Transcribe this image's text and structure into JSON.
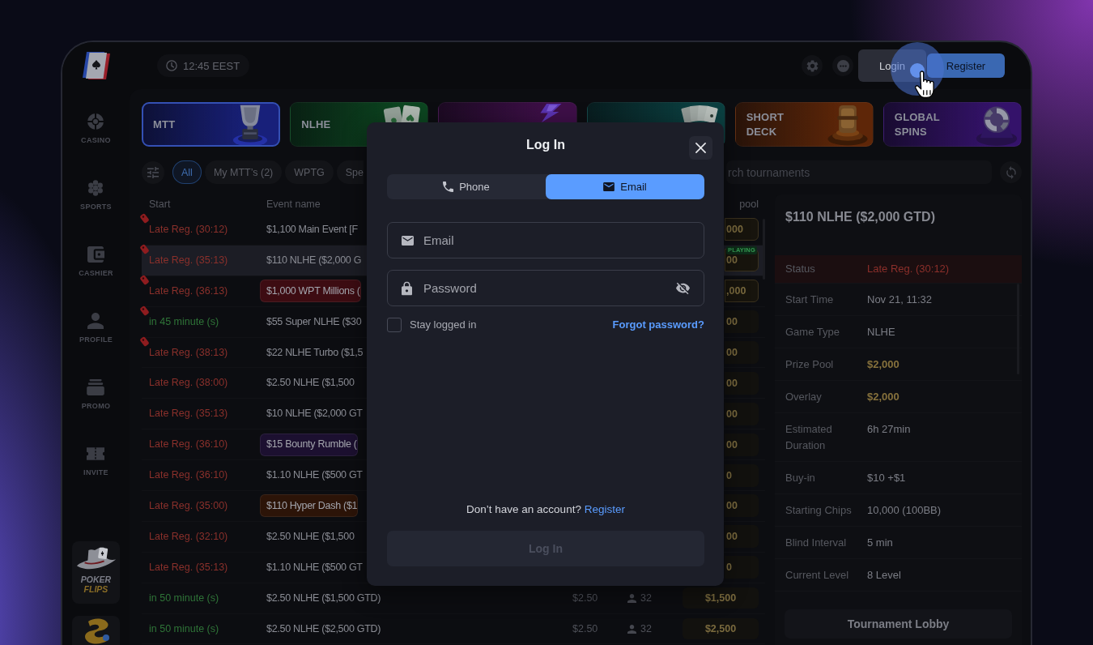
{
  "sidebar": {
    "items": [
      {
        "label": "CASINO"
      },
      {
        "label": "SPORTS"
      },
      {
        "label": "CASHIER"
      },
      {
        "label": "PROFILE"
      },
      {
        "label": "PROMO"
      },
      {
        "label": "INVITE"
      }
    ],
    "promo": {
      "title": "POKER",
      "subtitle": "FLIPS"
    }
  },
  "top_bar": {
    "clock": "12:45 EEST",
    "buttons": [
      {
        "label": "Login",
        "kind": "secondary"
      },
      {
        "label": "Register",
        "kind": "primary"
      }
    ]
  },
  "game_tiles": [
    {
      "label": "MTT",
      "selected": true,
      "color": "#18207a"
    },
    {
      "label": "NLHE",
      "selected": false,
      "color": "#0c4520"
    },
    {
      "selected": false,
      "color": "#3e0f48"
    },
    {
      "selected": false,
      "color": "#0b3f40"
    },
    {
      "label": "SHORT DECK",
      "selected": false,
      "color": "#5e2608"
    },
    {
      "label": "GLOBAL SPINS",
      "selected": false,
      "color": "#34126a"
    }
  ],
  "filters": {
    "chips": [
      {
        "label": "All",
        "selected": true
      },
      {
        "label": "My MTT’s (2)",
        "selected": false
      },
      {
        "label": "WPTG",
        "selected": false
      },
      {
        "label": "Spe",
        "selected": false
      }
    ],
    "search": {
      "placeholder": "rch tournaments"
    }
  },
  "table": {
    "columns": [
      "Start",
      "Event name",
      "pool"
    ],
    "rows": [
      {
        "start": "Late Reg. (30:12)",
        "kind": "late",
        "hot": true,
        "event": "$1,100 Main Event [F",
        "prize": "000",
        "prize_highlighted": true,
        "selected": false
      },
      {
        "start": "Late Reg. (35:13)",
        "kind": "late",
        "hot": true,
        "event": "$110 NLHE ($2,000 G",
        "prize": "00",
        "prize_highlighted": true,
        "badge": "PLAYING",
        "selected": true
      },
      {
        "start": "Late Reg. (36:13)",
        "kind": "late",
        "hot": true,
        "event": "$1,000 WPT Millions (",
        "color": "#3d0c12",
        "prize": ",000",
        "prize_highlighted": true,
        "selected": false
      },
      {
        "start": "in 45 minute (s)",
        "kind": "upcoming",
        "hot": true,
        "event": "$55 Super NLHE ($30",
        "prize": "00",
        "prize_highlighted": false,
        "selected": false
      },
      {
        "start": "Late Reg. (38:13)",
        "kind": "late",
        "hot": true,
        "event": "$22 NLHE Turbo ($1,5",
        "prize": "00",
        "prize_highlighted": false,
        "selected": false
      },
      {
        "start": "Late Reg. (38:00)",
        "kind": "late",
        "hot": false,
        "event": "$2.50 NLHE ($1,500",
        "prize": "00",
        "prize_highlighted": false,
        "selected": false
      },
      {
        "start": "Late Reg. (35:13)",
        "kind": "late",
        "hot": false,
        "event": "$10 NLHE ($2,000 GT",
        "prize": "00",
        "prize_highlighted": false,
        "selected": false
      },
      {
        "start": "Late Reg. (36:10)",
        "kind": "late",
        "hot": false,
        "event": "$15 Bounty Rumble (",
        "color": "#1c1030",
        "prize": "00",
        "prize_highlighted": false,
        "selected": false
      },
      {
        "start": "Late Reg. (36:10)",
        "kind": "late",
        "hot": false,
        "event": "$1.10 NLHE ($500 GT",
        "prize": "0",
        "prize_highlighted": false,
        "selected": false
      },
      {
        "start": "Late Reg. (35:00)",
        "kind": "late",
        "hot": false,
        "event": "$110 Hyper Dash ($1",
        "color": "#2c1408",
        "prize": "00",
        "prize_highlighted": false,
        "selected": false
      },
      {
        "start": "Late Reg. (32:10)",
        "kind": "late",
        "hot": false,
        "event": "$2.50 NLHE ($1,500",
        "prize": "00",
        "prize_highlighted": false,
        "selected": false
      },
      {
        "start": "Late Reg. (35:13)",
        "kind": "late",
        "hot": false,
        "event": "$1.10 NLHE ($500 GT",
        "prize": "0",
        "prize_highlighted": false,
        "selected": false
      },
      {
        "start": "in 50 minute (s)",
        "kind": "upcoming",
        "hot": false,
        "event": "$2.50 NLHE ($1,500 GTD)",
        "buy_in": "$2.50",
        "players": "32",
        "prize": "$1,500",
        "prize_highlighted": false,
        "selected": false
      },
      {
        "start": "in 50 minute (s)",
        "kind": "upcoming",
        "hot": false,
        "event": "$2.50 NLHE ($2,500 GTD)",
        "buy_in": "$2.50",
        "players": "32",
        "prize": "$2,500",
        "prize_highlighted": false,
        "selected": false
      }
    ]
  },
  "detail": {
    "title": "$110 NLHE ($2,000 GTD)",
    "rows": [
      {
        "label": "Status",
        "value": "Late Reg. (30:12)",
        "kind": "alert"
      },
      {
        "label": "Start Time",
        "value": "Nov 21, 11:32",
        "kind": "plain"
      },
      {
        "label": "Game Type",
        "value": "NLHE",
        "kind": "plain"
      },
      {
        "label": "Prize Pool",
        "value": "$2,000",
        "kind": "money"
      },
      {
        "label": "Overlay",
        "value": "$2,000",
        "kind": "money"
      },
      {
        "label": "Estimated Duration",
        "value": "6h 27min",
        "kind": "plain"
      },
      {
        "label": "Buy-in",
        "value": "$10 +$1",
        "kind": "plain"
      },
      {
        "label": "Starting Chips",
        "value": "10,000 (100BB)",
        "kind": "plain"
      },
      {
        "label": "Blind Interval",
        "value": "5 min",
        "kind": "plain"
      },
      {
        "label": "Current Level",
        "value": "8 Level",
        "kind": "plain"
      }
    ],
    "button": "Tournament Lobby"
  },
  "modal": {
    "title": "Log In",
    "tabs": [
      {
        "label": "Phone",
        "selected": false
      },
      {
        "label": "Email",
        "selected": true
      }
    ],
    "fields": [
      {
        "kind": "email",
        "placeholder": "Email"
      },
      {
        "kind": "password",
        "placeholder": "Password"
      }
    ],
    "remember": {
      "label": "Stay logged in",
      "checked": false
    },
    "forgot_link": "Forgot password?",
    "signup": {
      "prompt": "Don’t have an account?",
      "link": "Register"
    },
    "submit": {
      "label": "Log In",
      "disabled": true
    }
  }
}
